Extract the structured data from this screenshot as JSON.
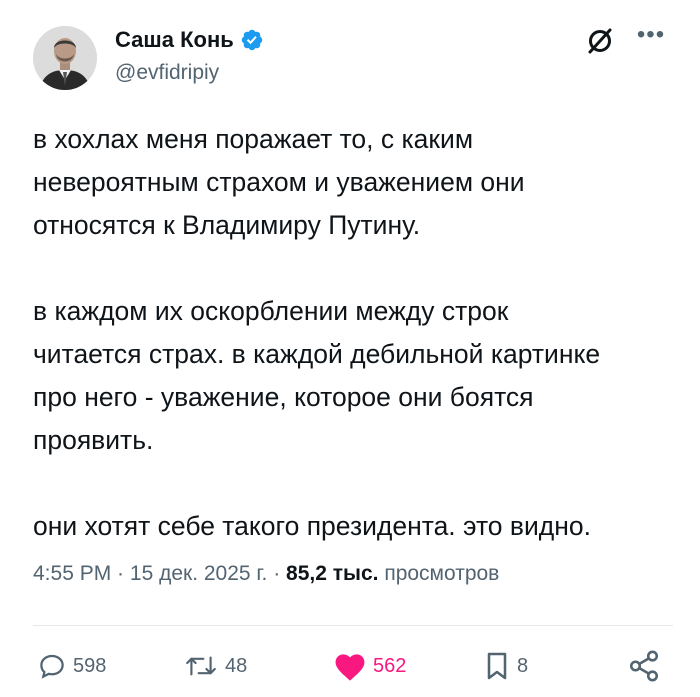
{
  "author": {
    "name": "Саша Конь",
    "handle": "@evfidripiy",
    "verified": true
  },
  "tweet": {
    "text": "в хохлах меня поражает то, с каким\nневероятным страхом и уважением они\nотносятся к Владимиру Путину.\n\nв каждом их оскорблении между строк\nчитается страх. в каждой дебильной картинке\nпро него - уважение, которое они боятся\nпроявить.\n\nони хотят себе такого президента. это видно."
  },
  "meta": {
    "time": "4:55 PM",
    "sep1": " · ",
    "date": "15 дек. 2025 г.",
    "sep2": " · ",
    "views_count": "85,2 тыс.",
    "views_label": " просмотров"
  },
  "actions": {
    "replies": "598",
    "reposts": "48",
    "likes": "562",
    "bookmarks": "8"
  },
  "icons": [
    "grok-icon",
    "more-icon",
    "reply-icon",
    "repost-icon",
    "like-icon",
    "bookmark-icon",
    "share-icon",
    "verified-badge-icon"
  ],
  "colors": {
    "text": "#0f1419",
    "secondary": "#536471",
    "verified": "#1d9bf0",
    "like": "#f91880"
  }
}
